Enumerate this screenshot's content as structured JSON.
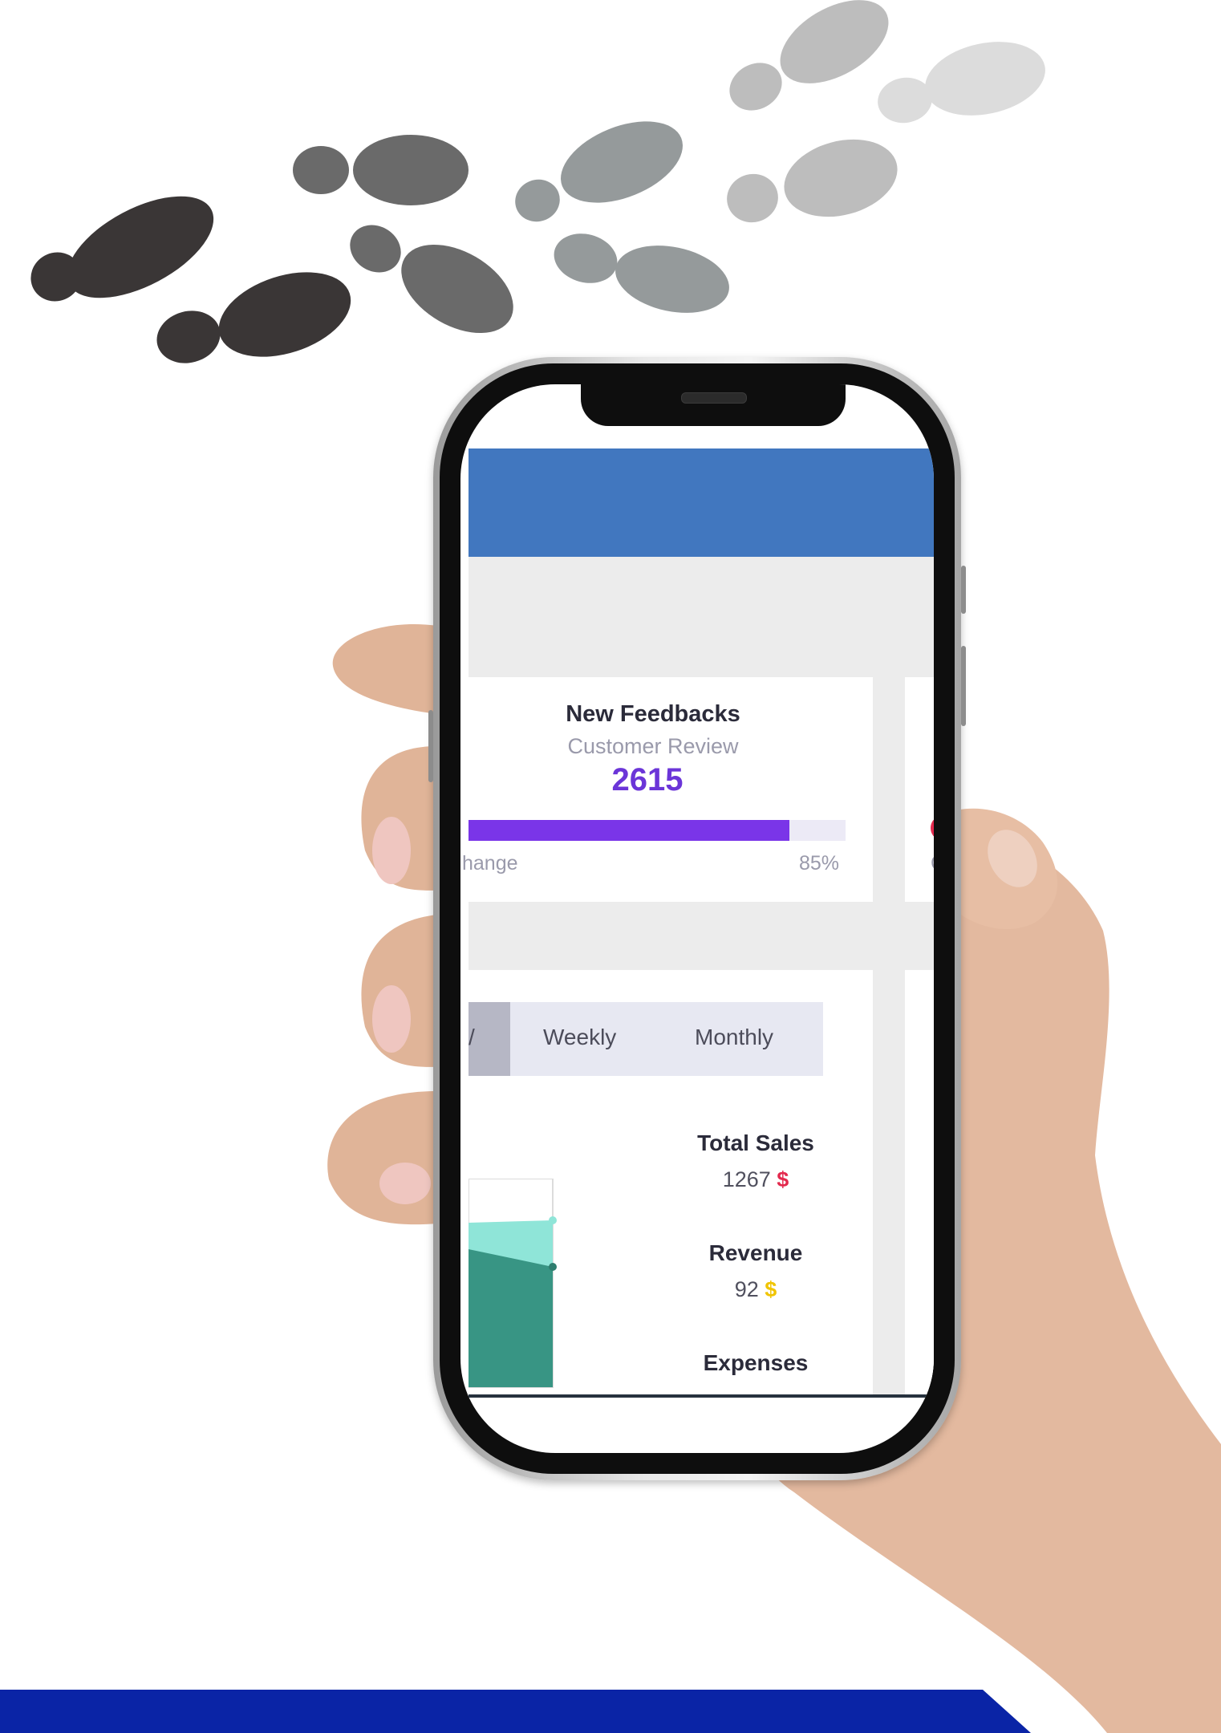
{
  "theme": {
    "accent": "#4177bf",
    "bottom_band": "#0a24a6",
    "progress_color": "#7a35e8",
    "count_color": "#6b35d8"
  },
  "decorations": {
    "top": "footprints-illustration",
    "center": "hand-holding-smartphone"
  },
  "feedback_card": {
    "title": "New Feedbacks",
    "subtitle": "Customer Review",
    "count": "2615",
    "progress_percent": 85,
    "change_label": "hange",
    "percent_label": "85%"
  },
  "side_card": {
    "letter": "C"
  },
  "sales_card": {
    "tabs": [
      {
        "label": "/",
        "active": true
      },
      {
        "label": "Weekly",
        "active": false
      },
      {
        "label": "Monthly",
        "active": false
      }
    ],
    "stats": [
      {
        "label": "Total Sales",
        "value": "1267",
        "currency": "$"
      },
      {
        "label": "Revenue",
        "value": "92",
        "currency": "$"
      },
      {
        "label": "Expenses"
      }
    ]
  }
}
